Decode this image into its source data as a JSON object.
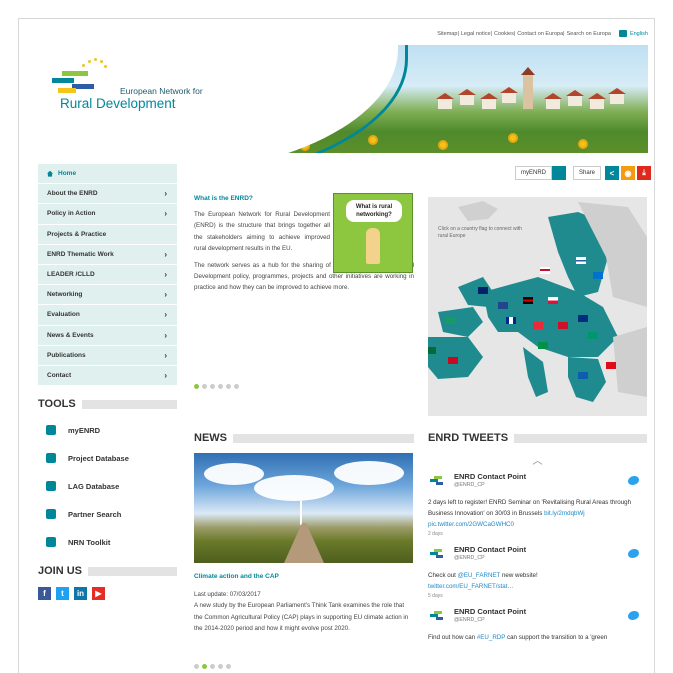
{
  "utility": {
    "links": [
      "Sitemap",
      "Legal notice",
      "Cookies",
      "Contact on Europa",
      "Search on Europa"
    ],
    "separator": "|",
    "language": "English"
  },
  "brand": {
    "line1": "European Network for",
    "line2": "Rural Development"
  },
  "nav": {
    "items": [
      {
        "label": "Home",
        "icon": "home-icon"
      },
      {
        "label": "About the ENRD",
        "chevron": true
      },
      {
        "label": "Policy in Action",
        "chevron": true
      },
      {
        "label": "Projects & Practice",
        "chevron": false
      },
      {
        "label": "ENRD Thematic Work",
        "chevron": true
      },
      {
        "label": "LEADER /CLLD",
        "chevron": true
      },
      {
        "label": "Networking",
        "chevron": true
      },
      {
        "label": "Evaluation",
        "chevron": true
      },
      {
        "label": "News & Events",
        "chevron": true
      },
      {
        "label": "Publications",
        "chevron": true
      },
      {
        "label": "Contact",
        "chevron": true
      }
    ],
    "chevron_glyph": "›"
  },
  "tools": {
    "heading": "TOOLS",
    "items": [
      {
        "label": "myENRD",
        "icon": "lock-icon"
      },
      {
        "label": "Project Database",
        "icon": "database-icon"
      },
      {
        "label": "LAG Database",
        "icon": "document-icon"
      },
      {
        "label": "Partner Search",
        "icon": "handshake-icon"
      },
      {
        "label": "NRN Toolkit",
        "icon": "gear-icon"
      }
    ]
  },
  "join": {
    "heading": "JOIN US",
    "networks": [
      {
        "label": "f",
        "icon": "facebook-icon",
        "color": "#3b5998"
      },
      {
        "label": "t",
        "icon": "twitter-icon",
        "color": "#1da1f2"
      },
      {
        "label": "in",
        "icon": "linkedin-icon",
        "color": "#0e76a8"
      },
      {
        "label": "▶",
        "icon": "youtube-icon",
        "color": "#e52d27"
      }
    ]
  },
  "toolbar": {
    "myenrd": "myENRD",
    "share": "Share",
    "share_color": "#00889a",
    "rss_color": "#f39c12",
    "pdf_color": "#e0291d"
  },
  "intro": {
    "title": "What is the ENRD?",
    "p1": "The European Network for Rural Development (ENRD) is the structure that brings together all the stakeholders aiming to achieve improved rural development results in the EU.",
    "p2": "The network serves as a hub for the sharing of information about how Rural Development policy, programmes, projects and other initiatives are working in practice and how they can be improved to achieve more.",
    "cartoon_bubble": "What is rural networking?",
    "slides": 6,
    "active_slide": 0
  },
  "map": {
    "hint": "Click on a country flag to connect with rural Europe"
  },
  "news": {
    "heading": "NEWS",
    "item_title": "Climate action and the CAP",
    "date": "Last update: 07/03/2017",
    "body": "A new study by the European Parliament's Think Tank examines the role that the Common Agricultural Policy (CAP) plays in supporting EU climate action in the 2014-2020 period and how it might evolve post 2020.",
    "slides": 6,
    "active_slide": 1
  },
  "tweets": {
    "heading": "ENRD TWEETS",
    "items": [
      {
        "name": "ENRD Contact Point",
        "handle": "@ENRD_CP",
        "text": "2 days left to register! ENRD Seminar on 'Revitalising Rural Areas through Business Innovation' on 30/03 in Brussels",
        "link": "bit.ly/2mdqbWj pic.twitter.com/2GWCaGWHC0",
        "age": "2 days"
      },
      {
        "name": "ENRD Contact Point",
        "handle": "@ENRD_CP",
        "text": "Check out",
        "mention": "@EU_FARNET",
        "text2": " new website!",
        "link": "twitter.com/EU_FARNET/stat…",
        "age": "5 days"
      },
      {
        "name": "ENRD Contact Point",
        "handle": "@ENRD_CP",
        "text": "Find out how can",
        "mention": "#EU_RDP",
        "text2": " can support the transition to a 'green"
      }
    ]
  }
}
